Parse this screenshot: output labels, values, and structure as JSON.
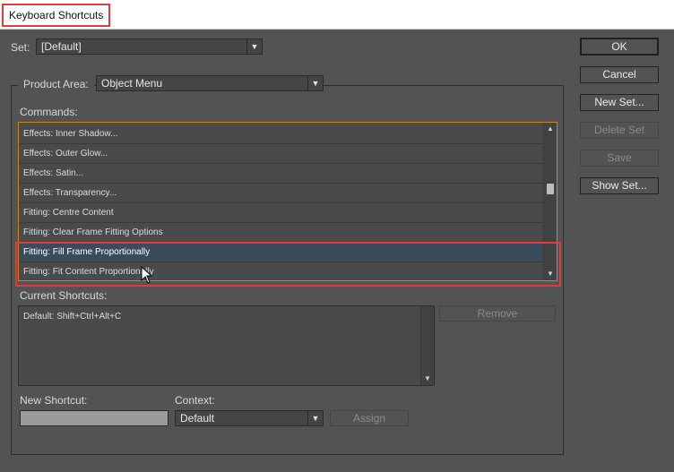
{
  "window": {
    "title": "Keyboard Shortcuts"
  },
  "set": {
    "label": "Set:",
    "value": "[Default]"
  },
  "product_area": {
    "label": "Product Area:",
    "value": "Object Menu"
  },
  "commands": {
    "label": "Commands:",
    "items": [
      "Effects: Inner Shadow...",
      "Effects: Outer Glow...",
      "Effects: Satin...",
      "Effects: Transparency...",
      "Fitting: Centre Content",
      "Fitting: Clear Frame Fitting Options",
      "Fitting: Fill Frame Proportionally",
      "Fitting: Fit Content Proportionally"
    ],
    "selected_index": 6
  },
  "current_shortcuts": {
    "label": "Current Shortcuts:",
    "items": [
      "Default: Shift+Ctrl+Alt+C"
    ]
  },
  "new_shortcut": {
    "label": "New Shortcut:",
    "value": ""
  },
  "context": {
    "label": "Context:",
    "value": "Default"
  },
  "buttons": {
    "ok": "OK",
    "cancel": "Cancel",
    "new_set": "New Set...",
    "delete_set": "Delete Set",
    "save": "Save",
    "show_set": "Show Set...",
    "remove": "Remove",
    "assign": "Assign"
  },
  "colors": {
    "highlight": "#e03c3c",
    "list_border": "#c7871d",
    "background": "#535353"
  }
}
